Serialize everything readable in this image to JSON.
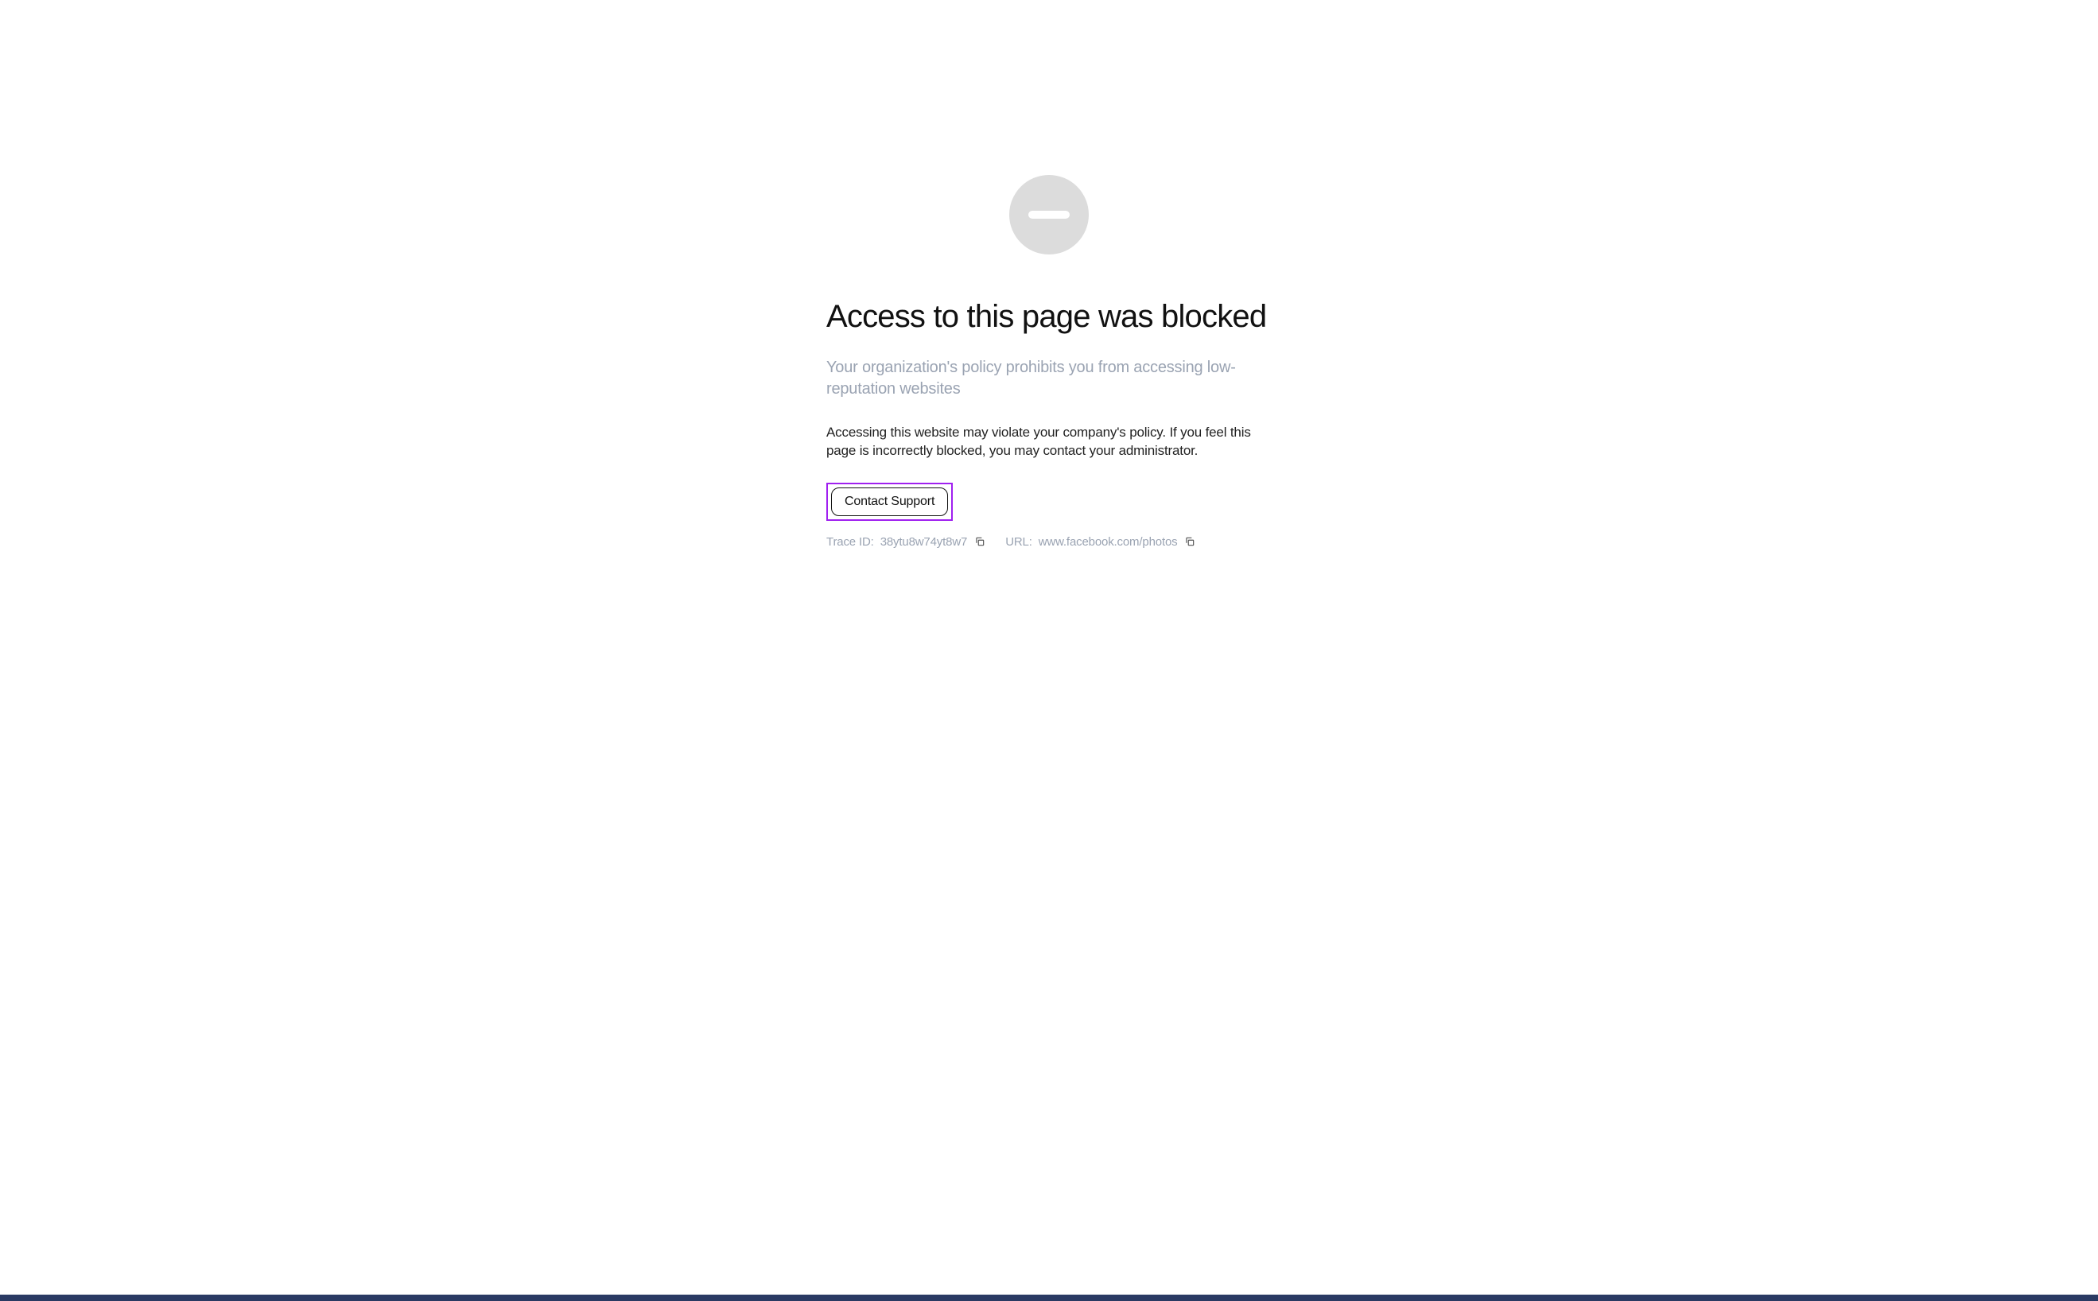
{
  "title": "Access to this page was blocked",
  "subtitle": "Your organization's policy prohibits you from accessing low-reputation websites",
  "description": "Accessing this website may violate your company's policy. If you feel this page is incorrectly blocked, you may contact your administrator.",
  "contact_button_label": "Contact Support",
  "footer": {
    "trace_label": "Trace ID:",
    "trace_value": "38ytu8w74yt8w7",
    "url_label": "URL:",
    "url_value": "www.facebook.com/photos"
  }
}
